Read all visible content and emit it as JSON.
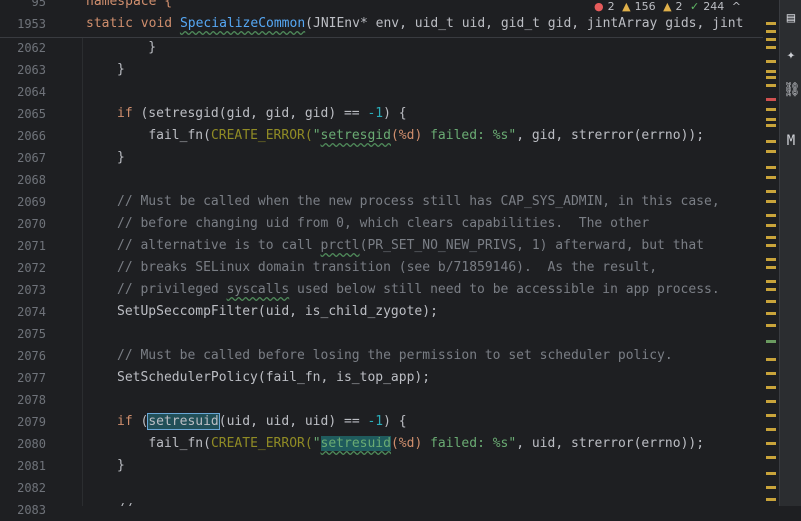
{
  "editor": {
    "sticky": {
      "line1_text": "namespace {",
      "line1_num": "95",
      "line2_num": "1953",
      "line2_kw1": "static",
      "line2_kw2": "void",
      "line2_fn": "SpecializeCommon",
      "line2_rest": "(JNIEnv* env, uid_t uid, gid_t gid, jintArray gids, jint"
    },
    "status": {
      "errors": "2",
      "warnings": "156",
      "weak_warnings": "2",
      "ok": "244"
    },
    "lines": [
      {
        "num": "2062",
        "text": "    }"
      },
      {
        "num": "2063",
        "text": "}"
      },
      {
        "num": "2064",
        "text": ""
      },
      {
        "num": "2065",
        "kw": "if",
        "pre": " (setresgid(gid, gid, gid) == ",
        "num_lit": "-1",
        "post": ") {"
      },
      {
        "num": "2066",
        "indent": "    ",
        "call": "fail_fn(",
        "macro": "CREATE_ERROR(",
        "str1": "\"",
        "sq": "setresgid",
        "fmt1": "(%d)",
        "str2": " failed: %s\"",
        "rest": ", gid, strerror(errno));"
      },
      {
        "num": "2067",
        "text": "}"
      },
      {
        "num": "2068",
        "text": ""
      },
      {
        "num": "2069",
        "comment": "// Must be called when the new process still has CAP_SYS_ADMIN, in this case,"
      },
      {
        "num": "2070",
        "comment": "// before changing uid from 0, which clears capabilities.  The other"
      },
      {
        "num": "2071",
        "comment_pre": "// alternative is to call ",
        "comment_sq": "prctl",
        "comment_post": "(PR_SET_NO_NEW_PRIVS, 1) afterward, but that"
      },
      {
        "num": "2072",
        "comment": "// breaks SELinux domain transition (see b/71859146).  As the result,"
      },
      {
        "num": "2073",
        "comment_pre": "// privileged ",
        "comment_sq": "syscalls",
        "comment_post": " used below still need to be accessible in app process."
      },
      {
        "num": "2074",
        "text": "SetUpSeccompFilter(uid, is_child_zygote);"
      },
      {
        "num": "2075",
        "text": ""
      },
      {
        "num": "2076",
        "comment": "// Must be called before losing the permission to set scheduler policy."
      },
      {
        "num": "2077",
        "text": "SetSchedulerPolicy(fail_fn, is_top_app);"
      },
      {
        "num": "2078",
        "text": ""
      },
      {
        "num": "2079",
        "kw": "if",
        "pre_a": " (",
        "hl": "setresuid",
        "pre_b": "(uid, uid, uid) == ",
        "num_lit": "-1",
        "post": ") {"
      },
      {
        "num": "2080",
        "indent": "    ",
        "call": "fail_fn(",
        "macro": "CREATE_ERROR(",
        "str1": "\"",
        "sq": "setresuid",
        "fmt1": "(%d)",
        "str2": " failed: %s\"",
        "rest": ", uid, strerror(errno));"
      },
      {
        "num": "2081",
        "text": "}"
      },
      {
        "num": "2082",
        "text": ""
      },
      {
        "num": "2083",
        "text": "//"
      }
    ]
  },
  "colors": {
    "background": "#1e1f22",
    "keyword": "#cf8e6d",
    "function": "#56a8f5",
    "string": "#6aab73",
    "comment": "#7a7e85",
    "number": "#2aacb8",
    "macro": "#908b25"
  },
  "rightbar_icons": [
    "file-icon",
    "sparkle-icon",
    "link-icon",
    "m-icon"
  ]
}
